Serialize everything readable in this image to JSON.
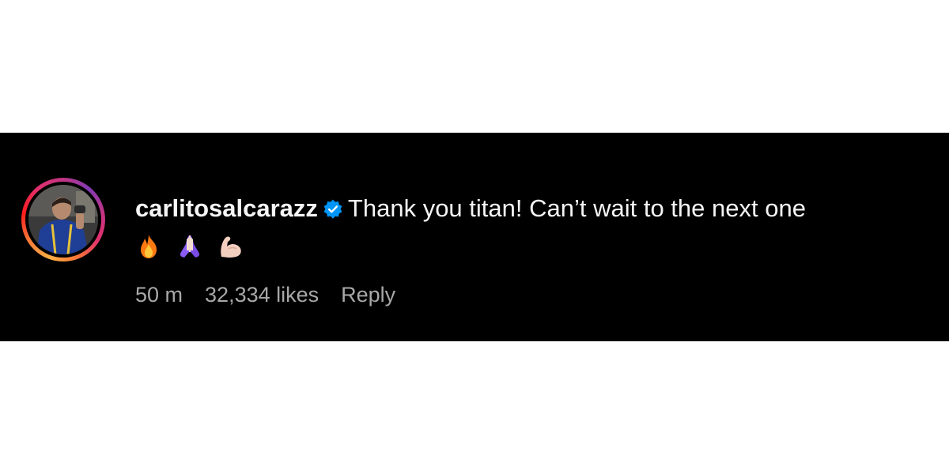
{
  "comment": {
    "username": "carlitosalcarazz",
    "verified_icon": "verified-badge-icon",
    "text": "Thank you titan! Can’t wait to the next one",
    "emojis": [
      "fire-emoji",
      "praying-hands-emoji",
      "flexed-biceps-emoji"
    ],
    "time": "50 m",
    "likes": "32,334 likes",
    "reply_label": "Reply"
  },
  "colors": {
    "background": "#000000",
    "text": "#f5f5f5",
    "meta": "#a8a8a8",
    "verified": "#0095f6"
  }
}
